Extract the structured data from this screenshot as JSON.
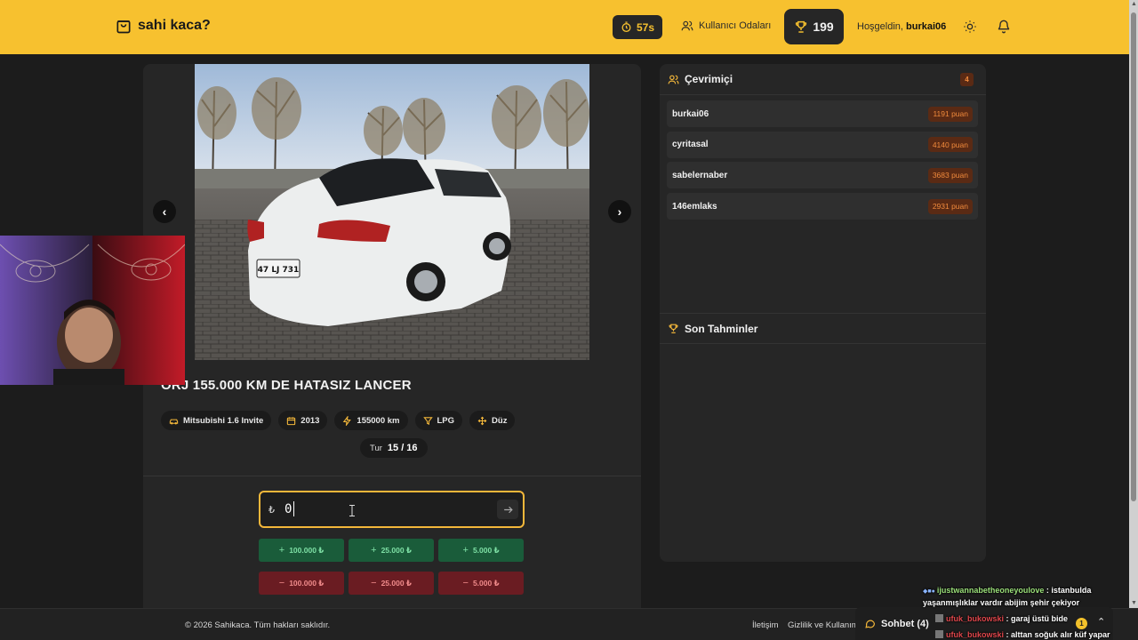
{
  "header": {
    "logo_text": "sahi kaca?",
    "timer": "57s",
    "rooms_label": "Kullanıcı Odaları",
    "score": "199",
    "greeting_prefix": "Hoşgeldin, ",
    "username": "burkai06",
    "accent_color": "#f7c12f"
  },
  "listing": {
    "title": "ORJ 155.000 KM DE HATASIZ LANCER",
    "specs": [
      {
        "icon": "car-icon",
        "label": "Mitsubishi 1.6 Invite"
      },
      {
        "icon": "calendar-icon",
        "label": "2013"
      },
      {
        "icon": "gauge-icon",
        "label": "155000 km"
      },
      {
        "icon": "fuel-icon",
        "label": "LPG"
      },
      {
        "icon": "gear-shift-icon",
        "label": "Düz"
      }
    ],
    "round_label": "Tur",
    "round_value": "15 / 16",
    "photo_plate": "47 LJ 731"
  },
  "guess": {
    "currency": "₺",
    "value": "0",
    "plus_buttons": [
      "100.000 ₺",
      "25.000 ₺",
      "5.000 ₺"
    ],
    "minus_buttons": [
      "100.000 ₺",
      "25.000 ₺",
      "5.000 ₺"
    ],
    "plus_sign": "+",
    "minus_sign": "−"
  },
  "online": {
    "title": "Çevrimiçi",
    "count": "4",
    "users": [
      {
        "name": "burkai06",
        "points": "1191 puan"
      },
      {
        "name": "cyritasal",
        "points": "4140 puan"
      },
      {
        "name": "sabelernaber",
        "points": "3683 puan"
      },
      {
        "name": "146emlaks",
        "points": "2931 puan"
      }
    ]
  },
  "recent": {
    "title": "Son Tahminler"
  },
  "footer": {
    "copyright": "© 2026 Sahikaca. Tüm hakları saklıdır.",
    "links": [
      "İletişim",
      "Gizlilik ve Kullanım"
    ],
    "chat_label": "Sohbet (4)",
    "chat_badge": "1"
  },
  "stream_chat": [
    {
      "user": "ijustwannabetheoneyoulove",
      "text": " : istanbulda"
    },
    {
      "user": "",
      "text": "yaşanmışlıklar vardır abijim şehir çekiyor"
    },
    {
      "user": "ufuk_bukowski",
      "text": " : garaj üstü bide"
    },
    {
      "user": "ufuk_bukowski",
      "text": " : alttan soğuk alır küf yapar"
    }
  ]
}
